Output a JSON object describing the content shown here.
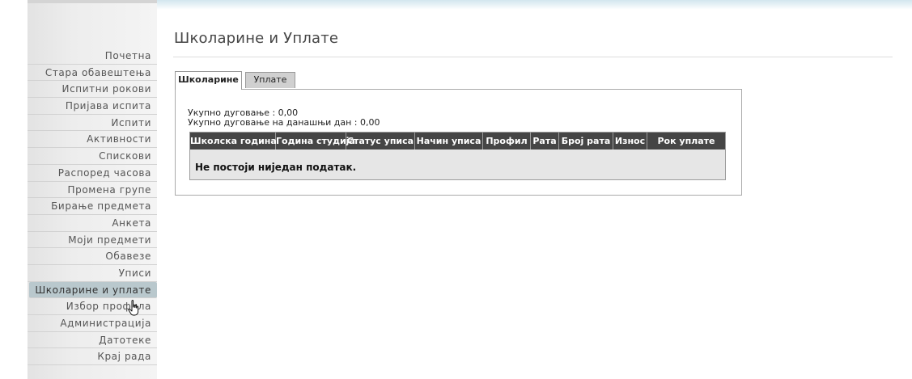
{
  "page": {
    "title": "Школарине и Уплате"
  },
  "sidebar": {
    "items": [
      {
        "label": "Почетна"
      },
      {
        "label": "Стара обавештења"
      },
      {
        "label": "Испитни рокови"
      },
      {
        "label": "Пријава испита"
      },
      {
        "label": "Испити"
      },
      {
        "label": "Активности"
      },
      {
        "label": "Спискови"
      },
      {
        "label": "Распоред часова"
      },
      {
        "label": "Промена групе"
      },
      {
        "label": "Бирање предмета"
      },
      {
        "label": "Анкета"
      },
      {
        "label": "Моји предмети"
      },
      {
        "label": "Обавезе"
      },
      {
        "label": "Уписи"
      },
      {
        "label": "Школарине и уплате",
        "active": true
      },
      {
        "label": "Избор профила"
      },
      {
        "label": "Администрација"
      },
      {
        "label": "Датотеке"
      },
      {
        "label": "Крај рада"
      }
    ]
  },
  "tabs": {
    "active": "Школарине",
    "inactive": "Уплате"
  },
  "summary": {
    "total_debt": "Укупно дуговање : 0,00",
    "debt_today": "Укупно дуговање на данашњи дан : 0,00"
  },
  "table": {
    "columns": [
      "Школска година",
      "Година студија",
      "Статус уписа",
      "Начин уписа",
      "Профил",
      "Рата",
      "Број рата",
      "Износ",
      "Рок уплате"
    ],
    "empty_message": "Не постоји ниједан податак."
  },
  "colors": {
    "header_bg": "#454545",
    "active_sidebar_bg": "#b9c8cd",
    "inactive_tab_bg": "#d0d0d0"
  }
}
